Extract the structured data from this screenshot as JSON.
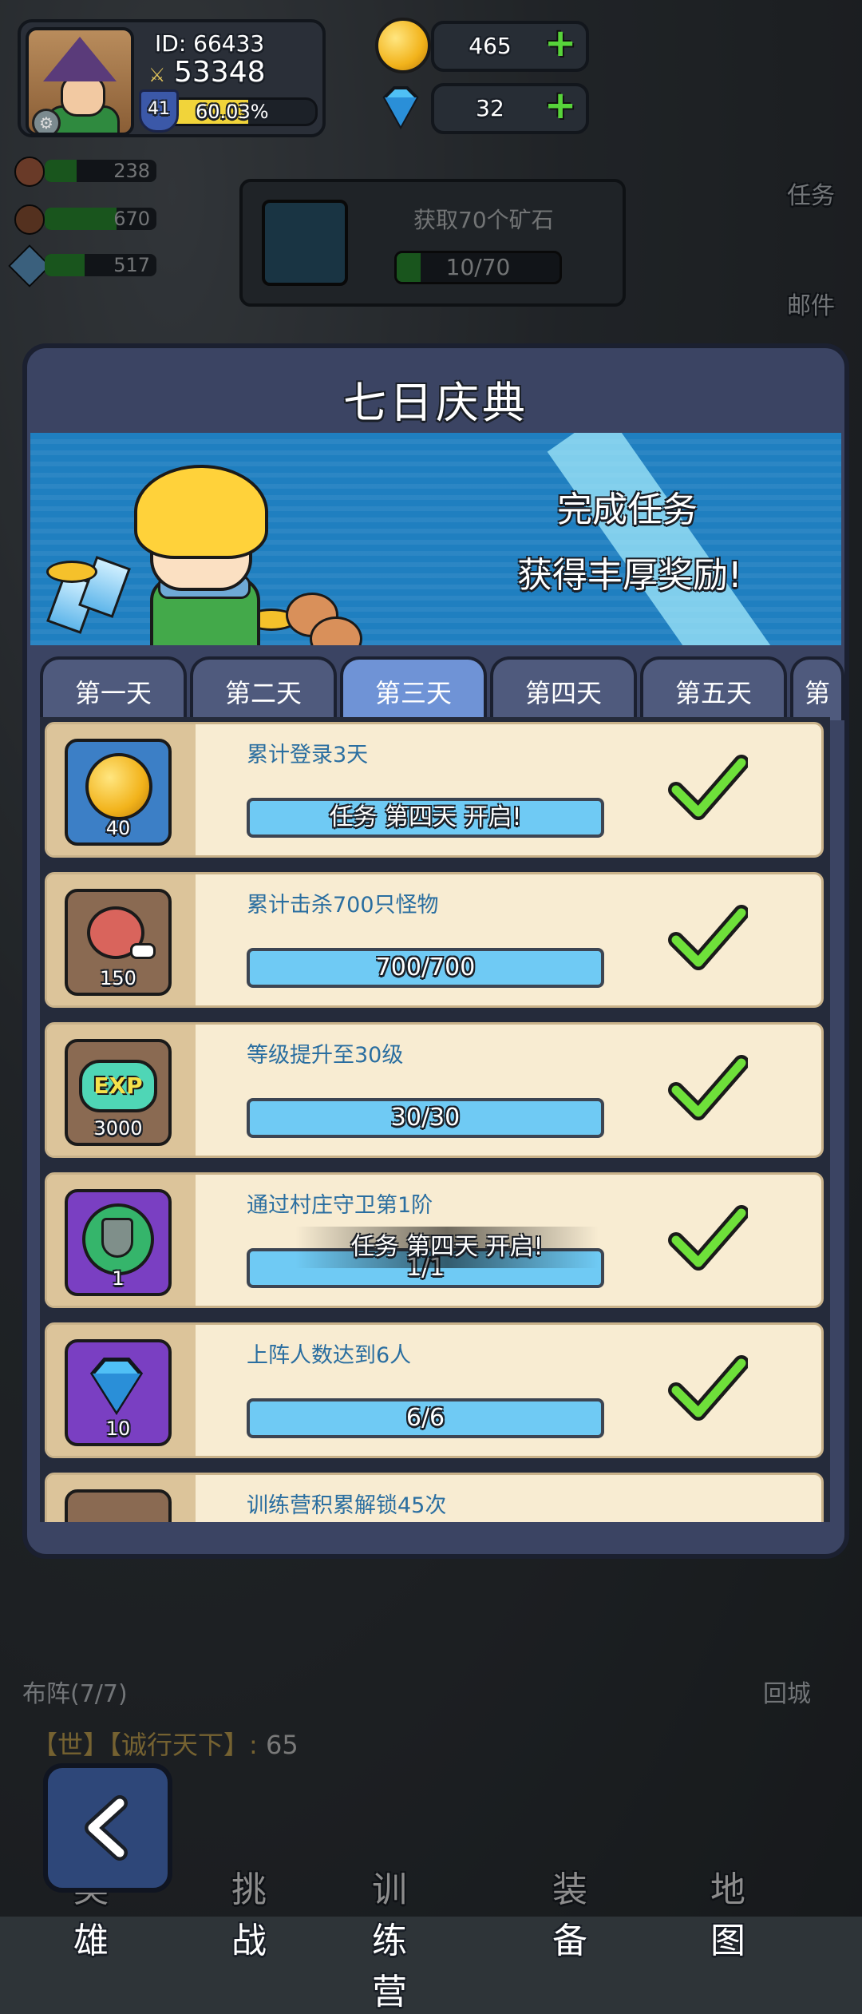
{
  "player": {
    "id_label": "ID: 66433",
    "power": "53348",
    "level": "41",
    "xp_percent_text": "60.03%",
    "xp_fraction": 0.6003
  },
  "currency": {
    "gold": "465",
    "gems": "32"
  },
  "resources": [
    {
      "icon": "drumstick-icon",
      "value": "238"
    },
    {
      "icon": "meat-icon",
      "value": "670"
    },
    {
      "icon": "crystal-icon",
      "value": "517"
    }
  ],
  "mission_behind": {
    "title": "获取70个矿石",
    "progress": "10/70",
    "fraction": 0.142
  },
  "side_buttons": {
    "tasks": "任务",
    "mail": "邮件",
    "lineup": "布阵(7/7)",
    "return_city": "回城"
  },
  "panel": {
    "title": "七日庆典",
    "banner_line1": "完成任务",
    "banner_line2": "获得丰厚奖励!",
    "tabs": [
      "第一天",
      "第二天",
      "第三天",
      "第四天",
      "第五天",
      "第"
    ],
    "active_tab": 2,
    "toast": "任务 第四天 开启!"
  },
  "tasks": [
    {
      "title": "累计登录3天",
      "reward_qty": "40",
      "reward_icon": "gold-coin-icon",
      "progress": "任务 第四天 开启!",
      "done": true
    },
    {
      "title": "累计击杀700只怪物",
      "reward_qty": "150",
      "reward_icon": "ham-icon",
      "progress": "700/700",
      "done": true
    },
    {
      "title": "等级提升至30级",
      "reward_qty": "3000",
      "reward_icon": "exp-icon",
      "progress": "30/30",
      "done": true
    },
    {
      "title": "通过村庄守卫第1阶",
      "reward_qty": "1",
      "reward_icon": "shield-badge-icon",
      "progress": "1/1",
      "done": true
    },
    {
      "title": "上阵人数达到6人",
      "reward_qty": "10",
      "reward_icon": "diamond-icon",
      "progress": "6/6",
      "done": true
    },
    {
      "title": "训练营积累解锁45次",
      "reward_qty": "",
      "reward_icon": "reward-icon",
      "progress": "",
      "done": true
    }
  ],
  "chat": {
    "channel": "【世】",
    "sender": "【诚行天下】:",
    "message": "65"
  },
  "bottom_nav": [
    "英雄",
    "挑战",
    "训练营",
    "装备",
    "地图"
  ],
  "colors": {
    "panel_bg": "#3b4463",
    "card_bg": "#f8ecd2",
    "progress_fill": "#6fcaf4",
    "check_green": "#6ee03a",
    "active_tab": "#6f93d6"
  }
}
